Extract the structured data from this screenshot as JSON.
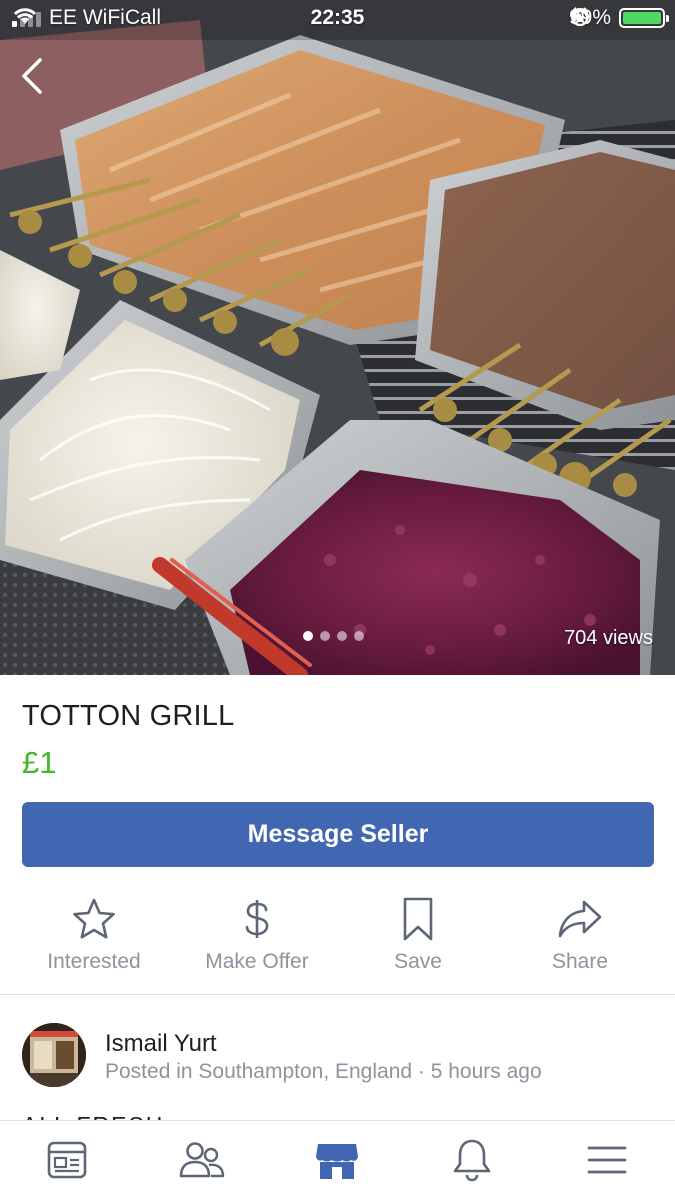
{
  "status_bar": {
    "carrier": "EE WiFiCall",
    "time": "22:35",
    "battery": "99%",
    "battery_level": 0.99,
    "signal_bars": 4,
    "signal_bars_active": 1
  },
  "gallery": {
    "views": "704 views",
    "photo_count": 4,
    "active_index": 0
  },
  "listing": {
    "title": "TOTTON GRILL",
    "price": "£1",
    "price_color": "#42b72a"
  },
  "primary_action": {
    "label": "Message Seller",
    "color": "#4267b2"
  },
  "actions": [
    {
      "label": "Interested",
      "icon": "star-icon"
    },
    {
      "label": "Make Offer",
      "icon": "dollar-icon"
    },
    {
      "label": "Save",
      "icon": "bookmark-icon"
    },
    {
      "label": "Share",
      "icon": "share-arrow-icon"
    }
  ],
  "seller": {
    "name": "Ismail Yurt",
    "meta": "Posted in Southampton, England · 5 hours ago"
  },
  "description_peek": "ALL FRESH",
  "tabs": [
    {
      "name": "news-feed",
      "icon": "news-feed-icon",
      "active": false
    },
    {
      "name": "friends",
      "icon": "friends-icon",
      "active": false
    },
    {
      "name": "marketplace",
      "icon": "marketplace-icon",
      "active": true
    },
    {
      "name": "notifications",
      "icon": "bell-icon",
      "active": false
    },
    {
      "name": "menu",
      "icon": "hamburger-menu-icon",
      "active": false
    }
  ],
  "colors": {
    "accent": "#4267b2",
    "tab_inactive": "#5d6675",
    "muted_text": "#8d949e"
  }
}
